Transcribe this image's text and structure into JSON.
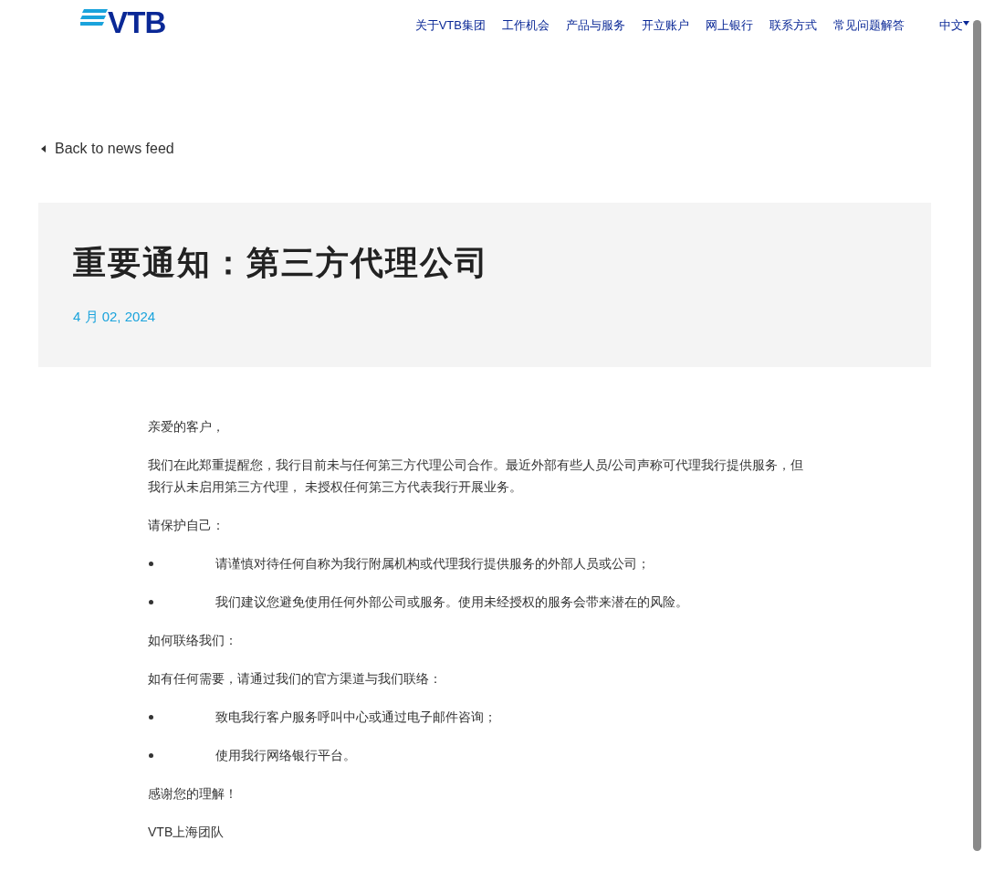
{
  "header": {
    "logo": "VTB",
    "nav": [
      "关于VTB集团",
      "工作机会",
      "产品与服务",
      "开立账户",
      "网上银行",
      "联系方式",
      "常见问题解答"
    ],
    "language": "中文"
  },
  "back_link": "Back to news feed",
  "article": {
    "title": "重要通知：第三方代理公司",
    "date": "4 月 02, 2024",
    "body": [
      {
        "kind": "paragraph",
        "text": "亲爱的客户，"
      },
      {
        "kind": "paragraph",
        "text": "我们在此郑重提醒您，我行目前未与任何第三方代理公司合作。最近外部有些人员/公司声称可代理我行提供服务，但我行从未启用第三方代理， 未授权任何第三方代表我行开展业务。"
      },
      {
        "kind": "paragraph",
        "text": "请保护自己："
      },
      {
        "kind": "bullet",
        "text": "请谨慎对待任何自称为我行附属机构或代理我行提供服务的外部人员或公司；"
      },
      {
        "kind": "bullet",
        "text": "我们建议您避免使用任何外部公司或服务。使用未经授权的服务会带来潜在的风险。"
      },
      {
        "kind": "paragraph",
        "text": "如何联络我们："
      },
      {
        "kind": "paragraph",
        "text": "如有任何需要，请通过我们的官方渠道与我们联络："
      },
      {
        "kind": "bullet",
        "text": "致电我行客户服务呼叫中心或通过电子邮件咨询；"
      },
      {
        "kind": "bullet",
        "text": "使用我行网络银行平台。"
      },
      {
        "kind": "paragraph",
        "text": "感谢您的理解！"
      },
      {
        "kind": "paragraph",
        "text": "VTB上海团队"
      }
    ]
  }
}
